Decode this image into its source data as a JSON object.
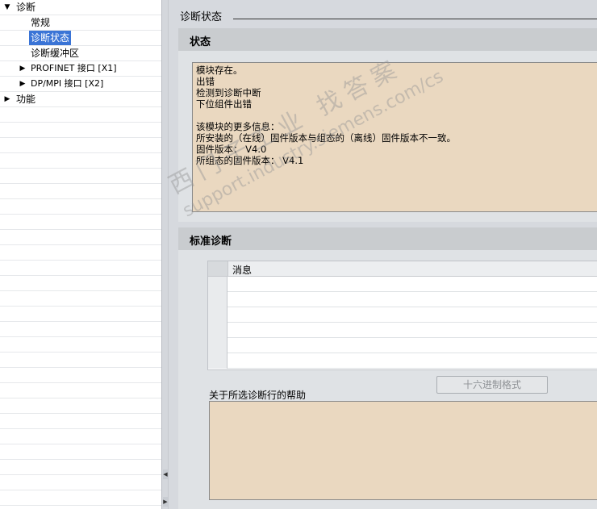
{
  "tree": {
    "items": [
      {
        "label": "诊断",
        "expanded": true,
        "arrow": "▼"
      },
      {
        "label": "常规"
      },
      {
        "label": "诊断状态",
        "selected": true
      },
      {
        "label": "诊断缓冲区"
      },
      {
        "label": "PROFINET 接口 [X1]",
        "arrow": "▶"
      },
      {
        "label": "DP/MPI 接口 [X2]",
        "arrow": "▶"
      },
      {
        "label": "功能",
        "arrow": "▶"
      }
    ]
  },
  "section_title": "诊断状态",
  "status_panel": {
    "title": "状态",
    "lines": [
      "模块存在。",
      "出错",
      "检测到诊断中断",
      "下位组件出错",
      "",
      "该模块的更多信息：",
      "所安装的（在线）固件版本与组态的（离线）固件版本不一致。",
      "固件版本： V4.0",
      "所组态的固件版本： V4.1"
    ]
  },
  "std_panel": {
    "title": "标准诊断",
    "table_header": "消息",
    "hex_button": "十六进制格式",
    "help_label": "关于所选诊断行的帮助"
  },
  "watermark": {
    "line1": "西门子工业 找答案",
    "line2": "support.industry.siemens.com/cs"
  },
  "colors": {
    "selection": "#3a74d6",
    "textbox_bg": "#ead8c0",
    "panel_bg": "#c9cccf"
  }
}
